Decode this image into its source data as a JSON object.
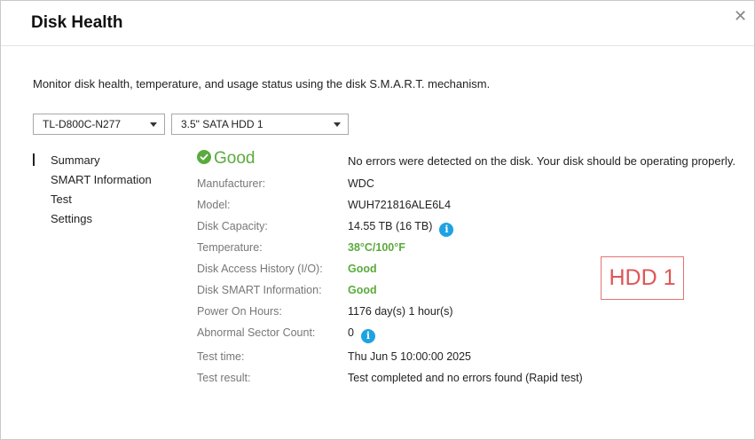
{
  "dialog": {
    "title": "Disk Health",
    "description": "Monitor disk health, temperature, and usage status using the disk S.M.A.R.T. mechanism."
  },
  "selectors": {
    "enclosure": "TL-D800C-N277",
    "disk": "3.5\" SATA HDD 1"
  },
  "nav": {
    "items": [
      {
        "label": "Summary",
        "active": true
      },
      {
        "label": "SMART Information",
        "active": false
      },
      {
        "label": "Test",
        "active": false
      },
      {
        "label": "Settings",
        "active": false
      }
    ]
  },
  "summary": {
    "status": "Good",
    "status_message": "No errors were detected on the disk. Your disk should be operating properly.",
    "rows": [
      {
        "label": "Manufacturer:",
        "value": "WDC"
      },
      {
        "label": "Model:",
        "value": "WUH721816ALE6L4"
      },
      {
        "label": "Disk Capacity:",
        "value": "14.55 TB (16 TB)"
      },
      {
        "label": "Temperature:",
        "value": "38°C/100°F"
      },
      {
        "label": "Disk Access History (I/O):",
        "value": "Good"
      },
      {
        "label": "Disk SMART Information:",
        "value": "Good"
      },
      {
        "label": "Power On Hours:",
        "value": "1176 day(s) 1 hour(s)"
      },
      {
        "label": "Abnormal Sector Count:",
        "value": "0"
      },
      {
        "label": "Test time:",
        "value": "Thu Jun 5 10:00:00 2025"
      },
      {
        "label": "Test result:",
        "value": "Test completed and no errors found (Rapid test)"
      }
    ],
    "info_icon_glyph": "i"
  },
  "badge": {
    "label": "HDD 1"
  },
  "colors": {
    "good_green": "#5aab3d",
    "info_blue": "#1ea3e2",
    "badge_red": "#e05555"
  }
}
